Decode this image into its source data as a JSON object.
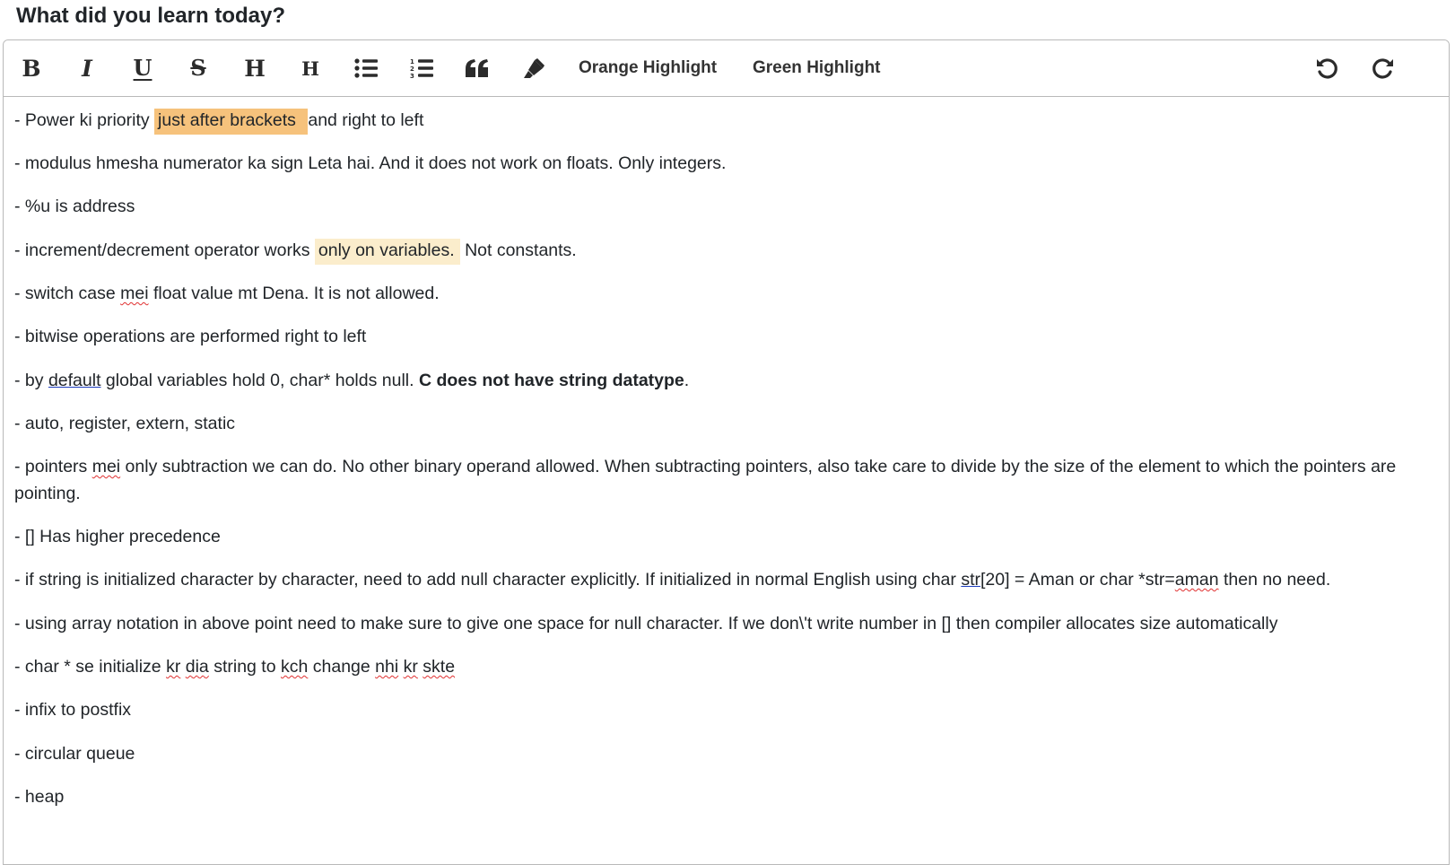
{
  "page": {
    "title": "What did you learn today?"
  },
  "toolbar": {
    "bold": "B",
    "italic": "I",
    "underline": "U",
    "strike": "S",
    "h1": "H",
    "h2": "H",
    "orange_highlight": "Orange Highlight",
    "green_highlight": "Green Highlight",
    "icons": [
      "bold-icon",
      "italic-icon",
      "underline-icon",
      "strikethrough-icon",
      "heading-1-icon",
      "heading-2-icon",
      "bullet-list-icon",
      "ordered-list-icon",
      "blockquote-icon",
      "highlighter-icon",
      "undo-icon",
      "redo-icon"
    ]
  },
  "colors": {
    "orange_highlight": "#f6c27c",
    "green_highlight": "#fbedcc",
    "border": "#b9b9b9",
    "text": "#212529"
  },
  "notes": {
    "l1": {
      "a": "- Power ki priority ",
      "hl": "just after brackets ",
      "b": " and right to left"
    },
    "l2": "- modulus hmesha numerator ka sign Leta hai. And it does not work on floats. Only integers.",
    "l3": "- %u is address",
    "l4": {
      "a": "- increment/decrement operator works ",
      "hl": "only on variables.",
      "b": " Not constants."
    },
    "l5": {
      "a": "- switch case ",
      "w": "mei",
      "b": " float value mt Dena. It is not allowed."
    },
    "l6": "- bitwise operations are performed right to left",
    "l7": {
      "a": "- by ",
      "u": "default",
      "b": " global variables hold 0, char* holds null. ",
      "bold": "C does not have string datatype",
      "c": "."
    },
    "l8": "- auto, register, extern, static",
    "l9": {
      "a": "- pointers ",
      "w": "mei",
      "b": " only subtraction we can do. No other binary operand allowed. When subtracting pointers, also take care to divide by the size of the element to which the pointers are pointing."
    },
    "l10": "- [] Has higher precedence",
    "l11": {
      "a": "- if string is initialized character by character, need to add null character explicitly. If initialized in normal English using char ",
      "u": "str",
      "b": "[20] = Aman or char *str=",
      "w": "aman",
      "c": " then no need."
    },
    "l12": "- using array notation in above point need to make sure to give one space for null character. If we don\\'t write number in [] then compiler allocates size automatically",
    "l13": {
      "a": "- char * se initialize ",
      "w1": "kr",
      "s1": " ",
      "w2": "dia",
      "b": " string to ",
      "w3": "kch",
      "c": " change ",
      "w4": "nhi",
      "s2": " ",
      "w5": "kr",
      "s3": " ",
      "w6": "skte"
    },
    "l14": "- infix to postfix",
    "l15": "- circular queue",
    "l16": "- heap"
  }
}
